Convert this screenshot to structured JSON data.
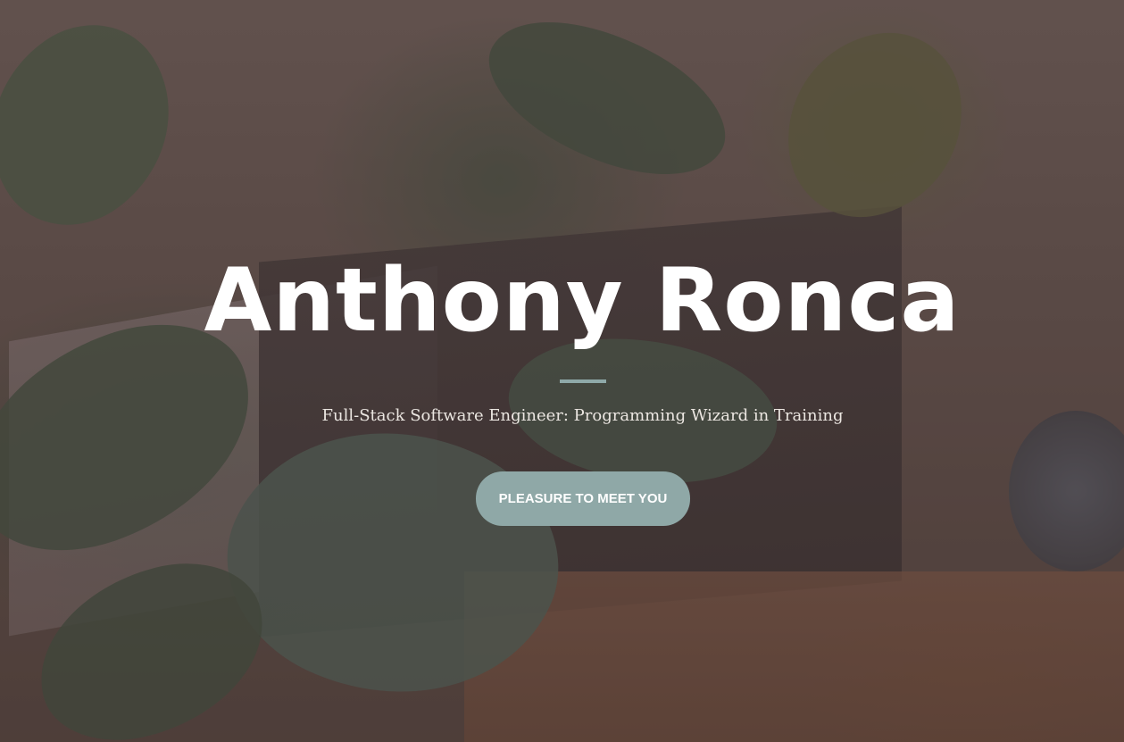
{
  "hero": {
    "name": "Anthony Ronca",
    "tagline": "Full-Stack Software Engineer: Programming Wizard in Training",
    "cta_label": "PLEASURE TO MEET YOU"
  },
  "colors": {
    "accent": "#8fa8a7",
    "title_text": "#ffffff",
    "tagline_text": "#ebe6e1",
    "overlay": "#503c3c"
  }
}
